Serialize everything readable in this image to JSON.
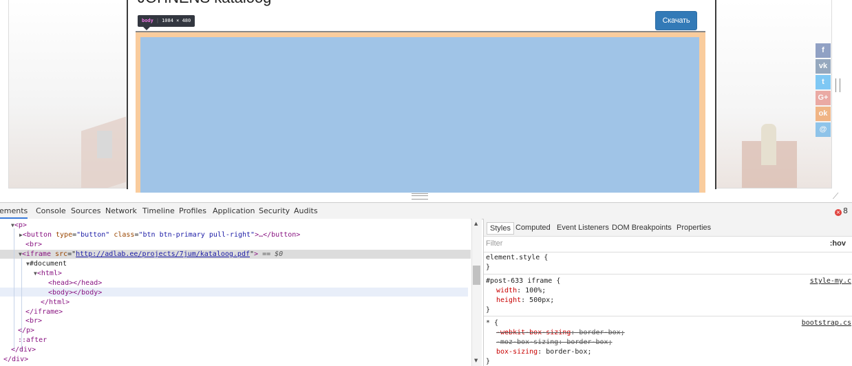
{
  "page": {
    "heading": "JOHNENS kataloog",
    "download_button": "Скачать",
    "tooltip": {
      "tag": "body",
      "size": "1084 × 480"
    },
    "share_buttons": [
      {
        "icon": "facebook-icon",
        "glyph": "f",
        "color": "#3b5998"
      },
      {
        "icon": "vk-icon",
        "glyph": "vk",
        "color": "#45668e"
      },
      {
        "icon": "twitter-icon",
        "glyph": "t",
        "color": "#1da1f2"
      },
      {
        "icon": "googleplus-icon",
        "glyph": "G+",
        "color": "#dc4e41"
      },
      {
        "icon": "odnoklassniki-icon",
        "glyph": "ok",
        "color": "#ed812b"
      },
      {
        "icon": "moimir-icon",
        "glyph": "@",
        "color": "#168de2"
      }
    ]
  },
  "devtools": {
    "tabs": [
      "Elements",
      "Console",
      "Sources",
      "Network",
      "Timeline",
      "Profiles",
      "Application",
      "Security",
      "Audits"
    ],
    "active_tab": "Elements",
    "error_count": "8",
    "dom": {
      "p_open": "<p>",
      "button_tag": "button",
      "button_type_attr": "type",
      "button_type_val": "\"button\"",
      "button_class_attr": "class",
      "button_class_val": "\"btn btn-primary pull-right\"",
      "button_rest": ">…</button>",
      "br": "<br>",
      "iframe_tag": "<iframe",
      "iframe_src_attr": "src",
      "iframe_src_val": "http://adlab.ee/projects/7jum/kataloog.pdf",
      "iframe_close_bracket": ">",
      "selected_marker": "== $0",
      "document": "#document",
      "html_open": "<html>",
      "head": "<head></head>",
      "body": "<body></body>",
      "html_close": "</html>",
      "iframe_close": "</iframe>",
      "br2": "<br>",
      "p_close": "</p>",
      "after": "::after",
      "div_close1": "</div>",
      "div_close2": "</div>"
    },
    "styles": {
      "tabs": [
        "Styles",
        "Computed",
        "Event Listeners",
        "DOM Breakpoints",
        "Properties"
      ],
      "filter_placeholder": "Filter",
      "hov": ":hov",
      "element_style": "element.style {",
      "close_brace": "}",
      "rule2_selector": "#post-633 iframe {",
      "rule2_source": "style-my.c",
      "rule2_p1_name": "width",
      "rule2_p1_value": "100%;",
      "rule2_p2_name": "height",
      "rule2_p2_value": "500px;",
      "rule3_selector": "* {",
      "rule3_source": "bootstrap.cs",
      "rule3_p1_name": "-webkit-box-sizing",
      "rule3_p1_value": "border-box;",
      "rule3_p2_name": "-moz-box-sizing",
      "rule3_p2_value": "border-box;",
      "rule3_p3_name": "box-sizing",
      "rule3_p3_value": "border-box;"
    }
  }
}
